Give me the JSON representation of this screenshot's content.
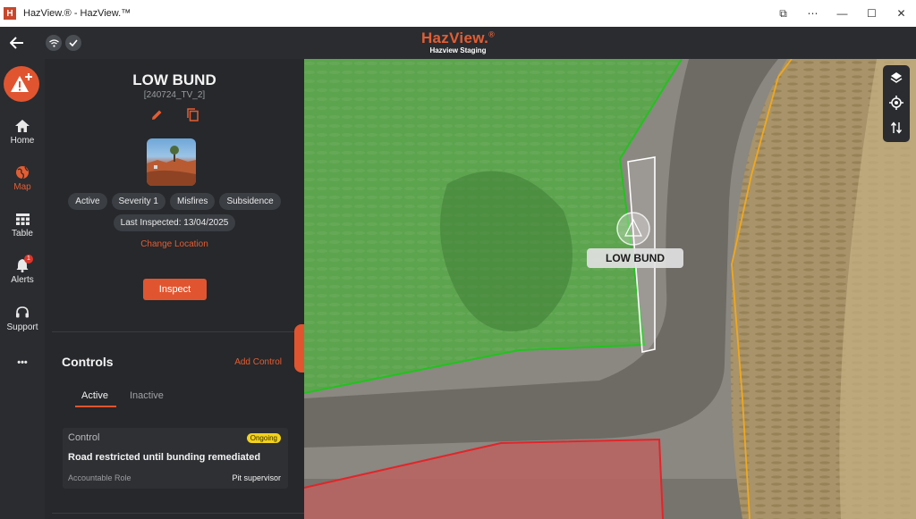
{
  "window": {
    "title": "HazView.® - HazView.™",
    "logo_letter": "H",
    "controls": [
      "⧉",
      "⋯",
      "—",
      "☐",
      "✕"
    ]
  },
  "appbar": {
    "brand": "HazView.",
    "brand_mark": "®",
    "environment": "Hazview  Staging"
  },
  "nav": {
    "items": [
      {
        "label": "Home",
        "icon": "home-icon"
      },
      {
        "label": "Map",
        "icon": "globe-icon",
        "active": true
      },
      {
        "label": "Table",
        "icon": "table-icon"
      },
      {
        "label": "Alerts",
        "icon": "bell-icon",
        "badge": "1"
      },
      {
        "label": "Support",
        "icon": "support-icon"
      },
      {
        "label": "•••",
        "icon": "more-icon"
      }
    ]
  },
  "hazard": {
    "title": "LOW BUND",
    "code": "[240724_TV_2]",
    "chips": [
      "Active",
      "Severity 1",
      "Misfires",
      "Subsidence"
    ],
    "last_inspected": "Last Inspected: 13/04/2025",
    "change_location": "Change Location",
    "inspect_label": "Inspect"
  },
  "controls": {
    "heading": "Controls",
    "add_label": "Add Control",
    "tabs": [
      "Active",
      "Inactive"
    ],
    "card": {
      "label": "Control",
      "status": "Ongoing",
      "description": "Road restricted until bunding remediated",
      "role_label": "Accountable Role",
      "role_value": "Pit supervisor"
    }
  },
  "map": {
    "marker_label": "LOW BUND",
    "colors": {
      "green_zone": "#22c21f",
      "red_zone": "#e0262a",
      "orange_line": "#f0a81c",
      "accent": "#e0552f"
    }
  }
}
